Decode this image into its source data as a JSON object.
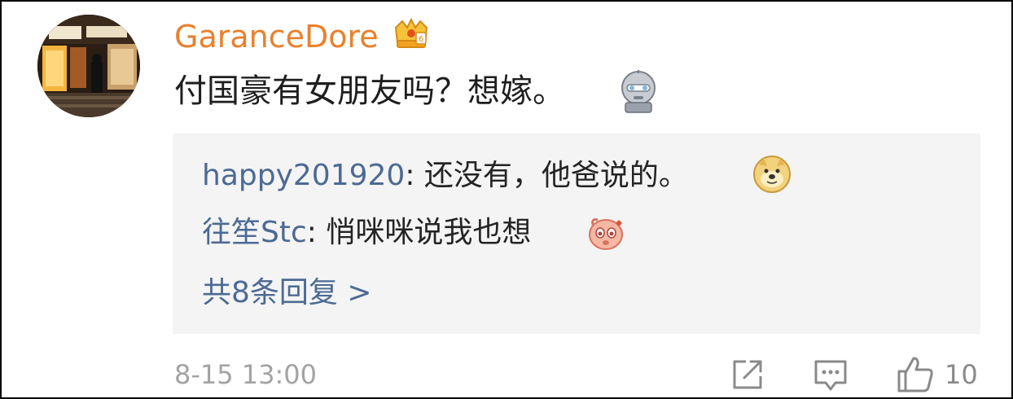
{
  "comment": {
    "username": "GaranceDore",
    "text": "付国豪有女朋友吗？想嫁。",
    "timestamp": "8-15 13:00",
    "like_count": "10"
  },
  "replies": [
    {
      "name": "happy201920",
      "separator": ": ",
      "text": "还没有，他爸说的。"
    },
    {
      "name": "往笙Stc",
      "separator": ": ",
      "text": "悄咪咪说我也想"
    }
  ],
  "more_replies": "共8条回复 >",
  "icons": {
    "vip": "crown-vip-icon",
    "emoji_1": "robot-emoji-icon",
    "emoji_2": "doge-emoji-icon",
    "emoji_3": "pink-face-emoji-icon",
    "share": "share-icon",
    "reply": "comment-icon",
    "like": "thumbs-up-icon"
  },
  "colors": {
    "username": "#e8812e",
    "link": "#4c6a93",
    "reply_background": "#f4f4f4",
    "meta": "#a3a3a3"
  }
}
